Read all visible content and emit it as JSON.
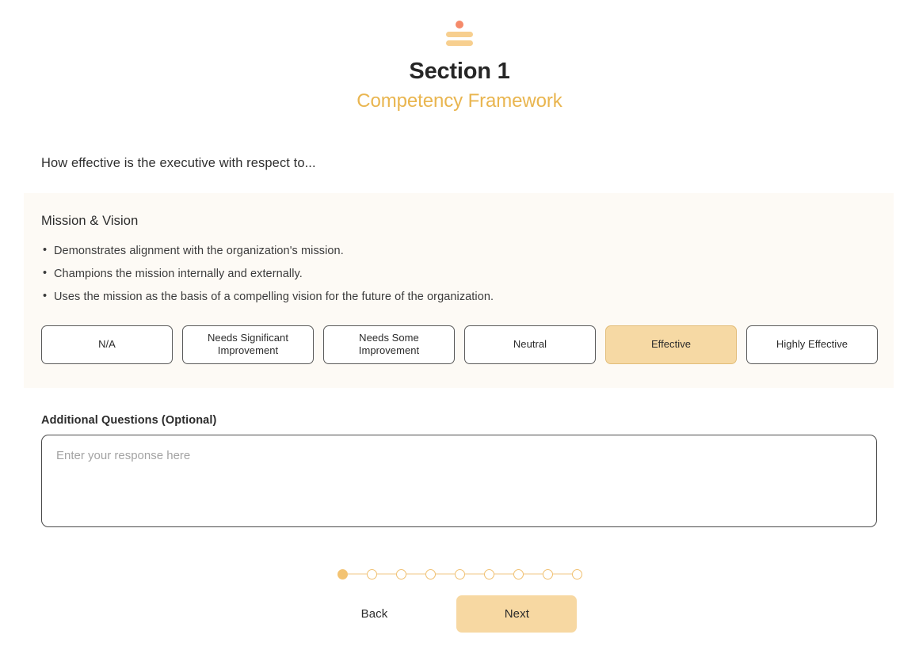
{
  "header": {
    "logo_icon": "stacked-bars-dot-logo",
    "title": "Section 1",
    "subtitle": "Competency Framework",
    "accent_color": "#e9b54f",
    "logo_dot_color": "#f58a6a",
    "logo_bar_color": "#f7cf8f"
  },
  "prompt": "How effective is the executive with respect to...",
  "competency": {
    "title": "Mission & Vision",
    "bullets": [
      "Demonstrates alignment with the organization's mission.",
      "Champions the mission internally and externally.",
      "Uses the mission as the basis of a compelling vision for the future of the organization."
    ],
    "card_background": "#fdfaf5",
    "options": [
      {
        "label": "N/A",
        "selected": false
      },
      {
        "label": "Needs Significant Improvement",
        "selected": false
      },
      {
        "label": "Needs Some Improvement",
        "selected": false
      },
      {
        "label": "Neutral",
        "selected": false
      },
      {
        "label": "Effective",
        "selected": true
      },
      {
        "label": "Highly Effective",
        "selected": false
      }
    ],
    "selected_color": "#f6d9a4"
  },
  "additional": {
    "label": "Additional Questions (Optional)",
    "placeholder": "Enter your response here",
    "value": ""
  },
  "progress": {
    "total": 9,
    "current": 1,
    "active_color": "#f3c372",
    "inactive_color": "#ffffff"
  },
  "nav": {
    "back_label": "Back",
    "next_label": "Next",
    "next_color": "#f7d8a2"
  }
}
